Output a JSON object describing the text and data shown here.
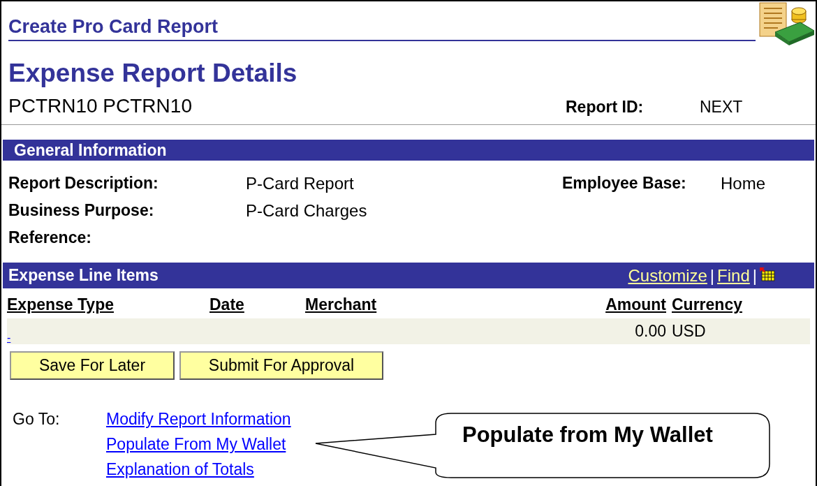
{
  "page": {
    "title": "Create Pro Card Report",
    "heading": "Expense Report Details",
    "user": "PCTRN10 PCTRN10",
    "report_id_label": "Report ID:",
    "report_id": "NEXT"
  },
  "general_information": {
    "title": "General Information",
    "fields": [
      {
        "label": "Report Description:",
        "value": "P-Card Report"
      },
      {
        "label": "Business Purpose:",
        "value": "P-Card Charges"
      },
      {
        "label": "Reference:"
      }
    ],
    "employee_base_label": "Employee Base:",
    "employee_base": "Home"
  },
  "expense_line_items": {
    "title": "Expense Line Items",
    "links": [
      "Customize",
      "Find"
    ],
    "separator": "|",
    "columns": [
      "Expense Type",
      "Date",
      "Merchant",
      "Amount",
      "Currency"
    ],
    "rows": [
      {
        "expense_type": "-",
        "amount": "0.00",
        "currency": "USD"
      }
    ]
  },
  "buttons": [
    "Save For Later",
    "Submit For Approval"
  ],
  "go_to": {
    "label": "Go To:",
    "links": [
      "Modify Report Information",
      "Populate From My Wallet",
      "Explanation of Totals"
    ]
  },
  "callout": {
    "text": "Populate from My Wallet"
  }
}
